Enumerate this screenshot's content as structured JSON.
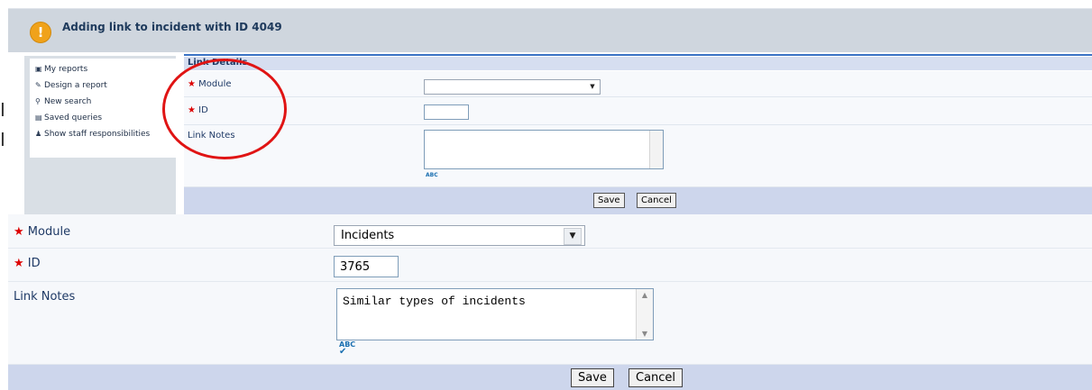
{
  "header": {
    "title": "Adding link to incident with ID 4049",
    "warning_icon": "!"
  },
  "sidebar": {
    "items": [
      {
        "label": "My reports",
        "icon": "report-icon",
        "glyph": "▣"
      },
      {
        "label": "Design a report",
        "icon": "pencil-icon",
        "glyph": "✎"
      },
      {
        "label": "New search",
        "icon": "search-icon",
        "glyph": "⚲"
      },
      {
        "label": "Saved queries",
        "icon": "saved-queries-icon",
        "glyph": "▤"
      },
      {
        "label": "Show staff responsibilities",
        "icon": "person-icon",
        "glyph": "♟"
      }
    ]
  },
  "link_form_original": {
    "section_title": "Link Details",
    "required_marker": "★",
    "module_label": "Module",
    "module_value": "",
    "id_label": "ID",
    "id_value": "",
    "notes_label": "Link Notes",
    "notes_value": "",
    "spellcheck_label": "ABC",
    "save_label": "Save",
    "cancel_label": "Cancel"
  },
  "link_form_filled": {
    "required_marker": "★",
    "module_label": "Module",
    "module_value": "Incidents",
    "id_label": "ID",
    "id_value": "3765",
    "notes_label": "Link Notes",
    "notes_value": "Similar types of incidents",
    "spellcheck_label": "ABC",
    "save_label": "Save",
    "cancel_label": "Cancel"
  },
  "colors": {
    "accent_blue": "#3b73c4",
    "header_bg": "#cfd6de",
    "footer_bg": "#cdd6ec",
    "required_star": "#dd0000",
    "highlight_circle": "#e01414",
    "warning": "#f0a21a"
  }
}
